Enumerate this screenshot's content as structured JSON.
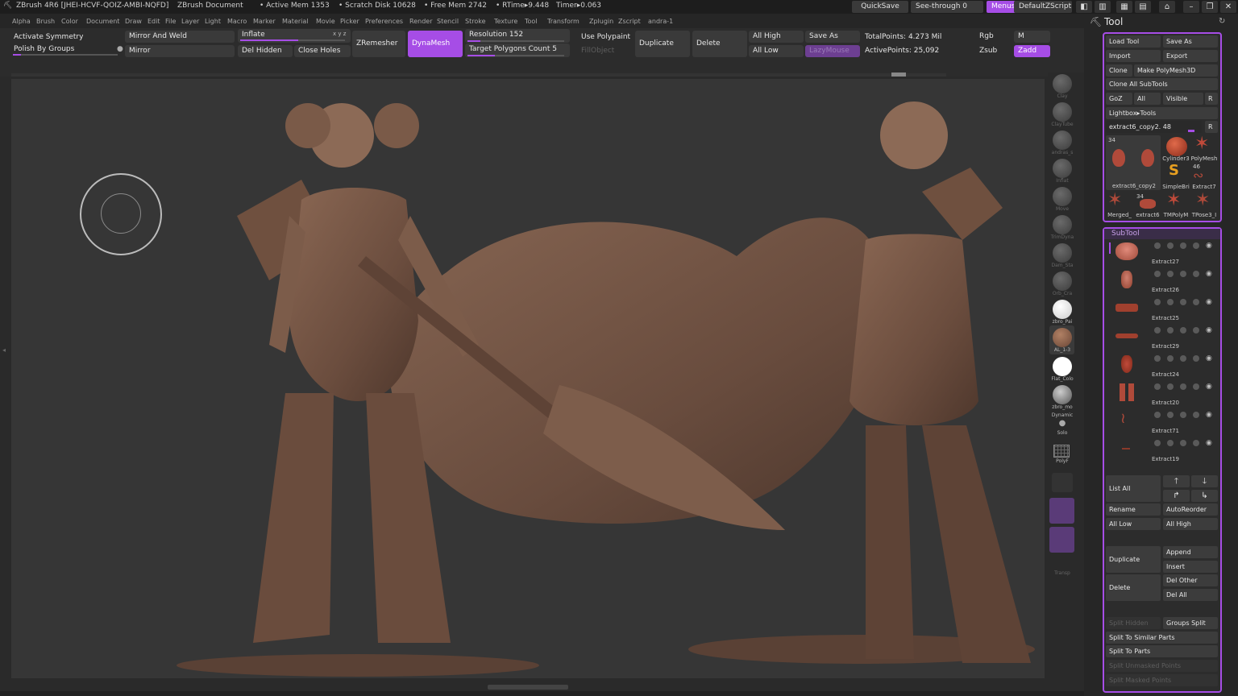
{
  "titlebar": {
    "app": "ZBrush 4R6 [JHEI-HCVF-QOIZ-AMBI-NQFD]",
    "document": "ZBrush Document",
    "active_mem": "• Active Mem 1353",
    "scratch": "• Scratch Disk 10628",
    "free_mem": "• Free Mem 2742",
    "rtime": "• RTime▸9.448",
    "timer": "Timer▸0.063",
    "quicksave": "QuickSave",
    "seethrough": "See-through",
    "seethrough_val": "0",
    "menus": "Menus",
    "script": "DefaultZScript"
  },
  "menubar": [
    "Alpha",
    "Brush",
    "Color",
    "Document",
    "Draw",
    "Edit",
    "File",
    "Layer",
    "Light",
    "Macro",
    "Marker",
    "Material",
    "Movie",
    "Picker",
    "Preferences",
    "Render",
    "Stencil",
    "Stroke",
    "Texture",
    "Tool",
    "Transform",
    "Zplugin",
    "Zscript",
    "andra-1"
  ],
  "toolbar": {
    "activate_symmetry": "Activate Symmetry",
    "polish_by_groups": "Polish By Groups",
    "mirror_and_weld": "Mirror And Weld",
    "mirror": "Mirror",
    "inflate": "Inflate",
    "inflate_xyz": "x y z",
    "del_hidden": "Del Hidden",
    "close_holes": "Close Holes",
    "zremesher": "ZRemesher",
    "dynamesh": "DynaMesh",
    "resolution": "Resolution 152",
    "target_polygons": "Target Polygons Count 5",
    "use_polypaint": "Use Polypaint",
    "fill_object": "FillObject",
    "duplicate": "Duplicate",
    "delete": "Delete",
    "all_high": "All High",
    "all_low": "All Low",
    "save_as": "Save As",
    "lazymouse": "LazyMouse",
    "total_points": "TotalPoints: 4.273 Mil",
    "active_points": "ActivePoints: 25,092",
    "rgb": "Rgb",
    "m": "M",
    "zsub": "Zsub",
    "zadd": "Zadd"
  },
  "tray": [
    {
      "label": "Clay"
    },
    {
      "label": "ClayTube"
    },
    {
      "label": "andras_s"
    },
    {
      "label": "Inflat"
    },
    {
      "label": "Move"
    },
    {
      "label": "TrimDyna"
    },
    {
      "label": "Dam_Sta"
    },
    {
      "label": "Orb_Cra"
    },
    {
      "label": "zbro_Pai"
    },
    {
      "label": "AL_1-3"
    },
    {
      "label": "Flat_Colo"
    },
    {
      "label": "zbro_mo"
    },
    {
      "label": "Dynamic"
    },
    {
      "label": "Solo"
    },
    {
      "label": "PolyF"
    },
    {
      "label": "Transp"
    }
  ],
  "tool_panel": {
    "title": "Tool",
    "load_tool": "Load Tool",
    "save_as": "Save As",
    "import": "Import",
    "export": "Export",
    "clone": "Clone",
    "make_polymesh": "Make PolyMesh3D",
    "clone_all": "Clone All SubTools",
    "goz": "GoZ",
    "all": "All",
    "visible": "Visible",
    "r": "R",
    "lightbox_tools": "Lightbox▸Tools",
    "current_tool": "extract6_copy2. 48",
    "thumbs": [
      {
        "name": "extract6_copy2",
        "count": "34"
      },
      {
        "name": "Cylinder3"
      },
      {
        "name": "PolyMesh"
      },
      {
        "name": "SimpleBri"
      },
      {
        "name": "Extract7",
        "count": "46"
      },
      {
        "name": "Merged_"
      },
      {
        "name": "extract6",
        "count": "34"
      },
      {
        "name": "TMPolyM"
      },
      {
        "name": "TPose3_I"
      }
    ],
    "subtool_title": "SubTool",
    "subtools": [
      "Extract27",
      "Extract26",
      "Extract25",
      "Extract29",
      "Extract24",
      "Extract20",
      "Extract71",
      "Extract19"
    ],
    "list_all": "List All",
    "rename": "Rename",
    "autoreorder": "AutoReorder",
    "all_low": "All Low",
    "all_high": "All High",
    "duplicate": "Duplicate",
    "append": "Append",
    "insert": "Insert",
    "delete": "Delete",
    "del_other": "Del Other",
    "del_all": "Del All",
    "split_hidden": "Split Hidden",
    "groups_split": "Groups Split",
    "split_similar": "Split To Similar Parts",
    "split_parts": "Split To Parts",
    "split_unmasked": "Split Unmasked Points",
    "split_masked": "Split Masked Points"
  },
  "colors": {
    "accent": "#a64de6",
    "clay": "#7a5846"
  }
}
